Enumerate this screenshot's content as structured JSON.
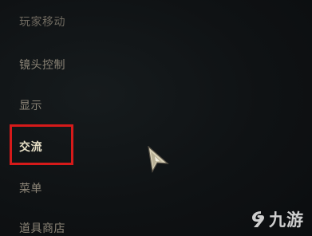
{
  "menu": {
    "items": [
      {
        "label": "玩家移动"
      },
      {
        "label": "镜头控制"
      },
      {
        "label": "显示"
      },
      {
        "label": "交流"
      },
      {
        "label": "菜单"
      },
      {
        "label": "道具商店"
      }
    ],
    "selected": "交流"
  },
  "annotation": {
    "highlight_color": "#d61a1a"
  },
  "cursor": {
    "icon": "game-pointer-icon"
  },
  "watermark": {
    "text": "九游",
    "icon": "jiuyou-logo-icon"
  }
}
